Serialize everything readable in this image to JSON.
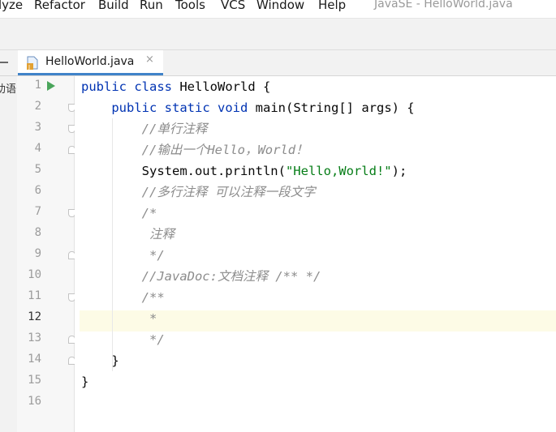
{
  "menu": {
    "items": [
      "lyze",
      "Refactor",
      "Build",
      "Run",
      "Tools",
      "VCS",
      "Window",
      "Help"
    ],
    "window_title": "JavaSE - HelloWorld.java"
  },
  "tab": {
    "label": "HelloWorld.java",
    "close_glyph": "×",
    "icon": "java-file-icon"
  },
  "left_strip": {
    "text": "助语"
  },
  "gutter": {
    "line_numbers": [
      "1",
      "2",
      "3",
      "4",
      "5",
      "6",
      "7",
      "8",
      "9",
      "10",
      "11",
      "12",
      "13",
      "14",
      "15",
      "16"
    ],
    "current_line": "12"
  },
  "code": {
    "l1": [
      "public",
      " ",
      "class",
      " HelloWorld {"
    ],
    "l2": [
      "public",
      " ",
      "static",
      " ",
      "void",
      " main(String[] args) {"
    ],
    "l3": "//单行注释",
    "l4": "//输出一个Hello，World！",
    "l5a": "System.out.println(",
    "l5s": "\"Hello,World!\"",
    "l5b": ");",
    "l6": "//多行注释 可以注释一段文字",
    "l7": "/*",
    "l8": " 注释",
    "l9": " */",
    "l10": "//JavaDoc:文档注释 /** */",
    "l11": "/**",
    "l12": " *",
    "l13": " */",
    "l14": "}",
    "l15": "}"
  },
  "colors": {
    "keyword": "#0033b3",
    "comment": "#8c8c8c",
    "string": "#067d17",
    "run_icon": "#4aa55b",
    "tab_underline": "#4083c9"
  }
}
